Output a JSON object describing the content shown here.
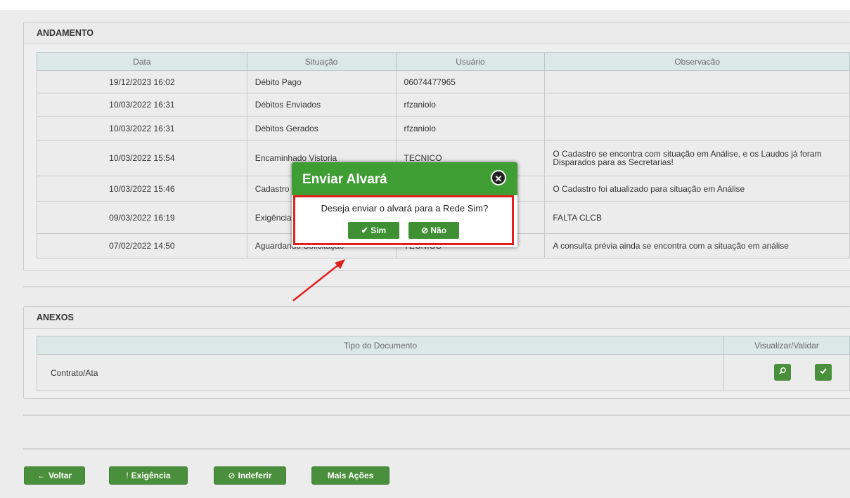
{
  "andamento": {
    "title": "ANDAMENTO",
    "headers": [
      "Data",
      "Situação",
      "Usuário",
      "Observacão"
    ],
    "rows": [
      [
        "19/12/2023 16:02",
        "Débito Pago",
        "06074477965",
        ""
      ],
      [
        "10/03/2022 16:31",
        "Débitos Enviados",
        "rfzaniolo",
        ""
      ],
      [
        "10/03/2022 16:31",
        "Débitos Gerados",
        "rfzaniolo",
        ""
      ],
      [
        "10/03/2022 15:54",
        "Encaminhado Vistoria",
        "TECNICO",
        "O Cadastro se encontra com situação em Análise, e os Laudos já foram Disparados para as Secretarias!"
      ],
      [
        "10/03/2022 15:46",
        "Cadastro",
        "",
        "O Cadastro foi atualizado para situação em Análise"
      ],
      [
        "09/03/2022 16:19",
        "Exigência",
        "",
        "FALTA CLCB"
      ],
      [
        "07/02/2022 14:50",
        "Aguardando Solicitação",
        "TECNICO",
        "A consulta prévia ainda se encontra com a situação em análise"
      ]
    ]
  },
  "anexos": {
    "title": "ANEXOS",
    "headers": [
      "Tipo do Documento",
      "Visualizar/Validar"
    ],
    "rows": [
      [
        "Contrato/Ata"
      ]
    ],
    "view_icon": "search-icon",
    "validate_icon": "check-icon"
  },
  "footer": {
    "voltar": "Voltar",
    "voltar_icon": "←",
    "exigencia": "Exigência",
    "exigencia_icon": "!",
    "indeferir": "Indeferir",
    "indeferir_icon": "⊘",
    "mais_acoes": "Mais Ações"
  },
  "modal": {
    "title": "Enviar Alvará",
    "message": "Deseja enviar o alvará para a Rede Sim?",
    "yes": "Sim",
    "no": "Não",
    "close_icon": "close-icon"
  },
  "colors": {
    "accent": "#4a8f3b",
    "modal_header": "#3f9e33",
    "highlight": "#e01f1f"
  }
}
